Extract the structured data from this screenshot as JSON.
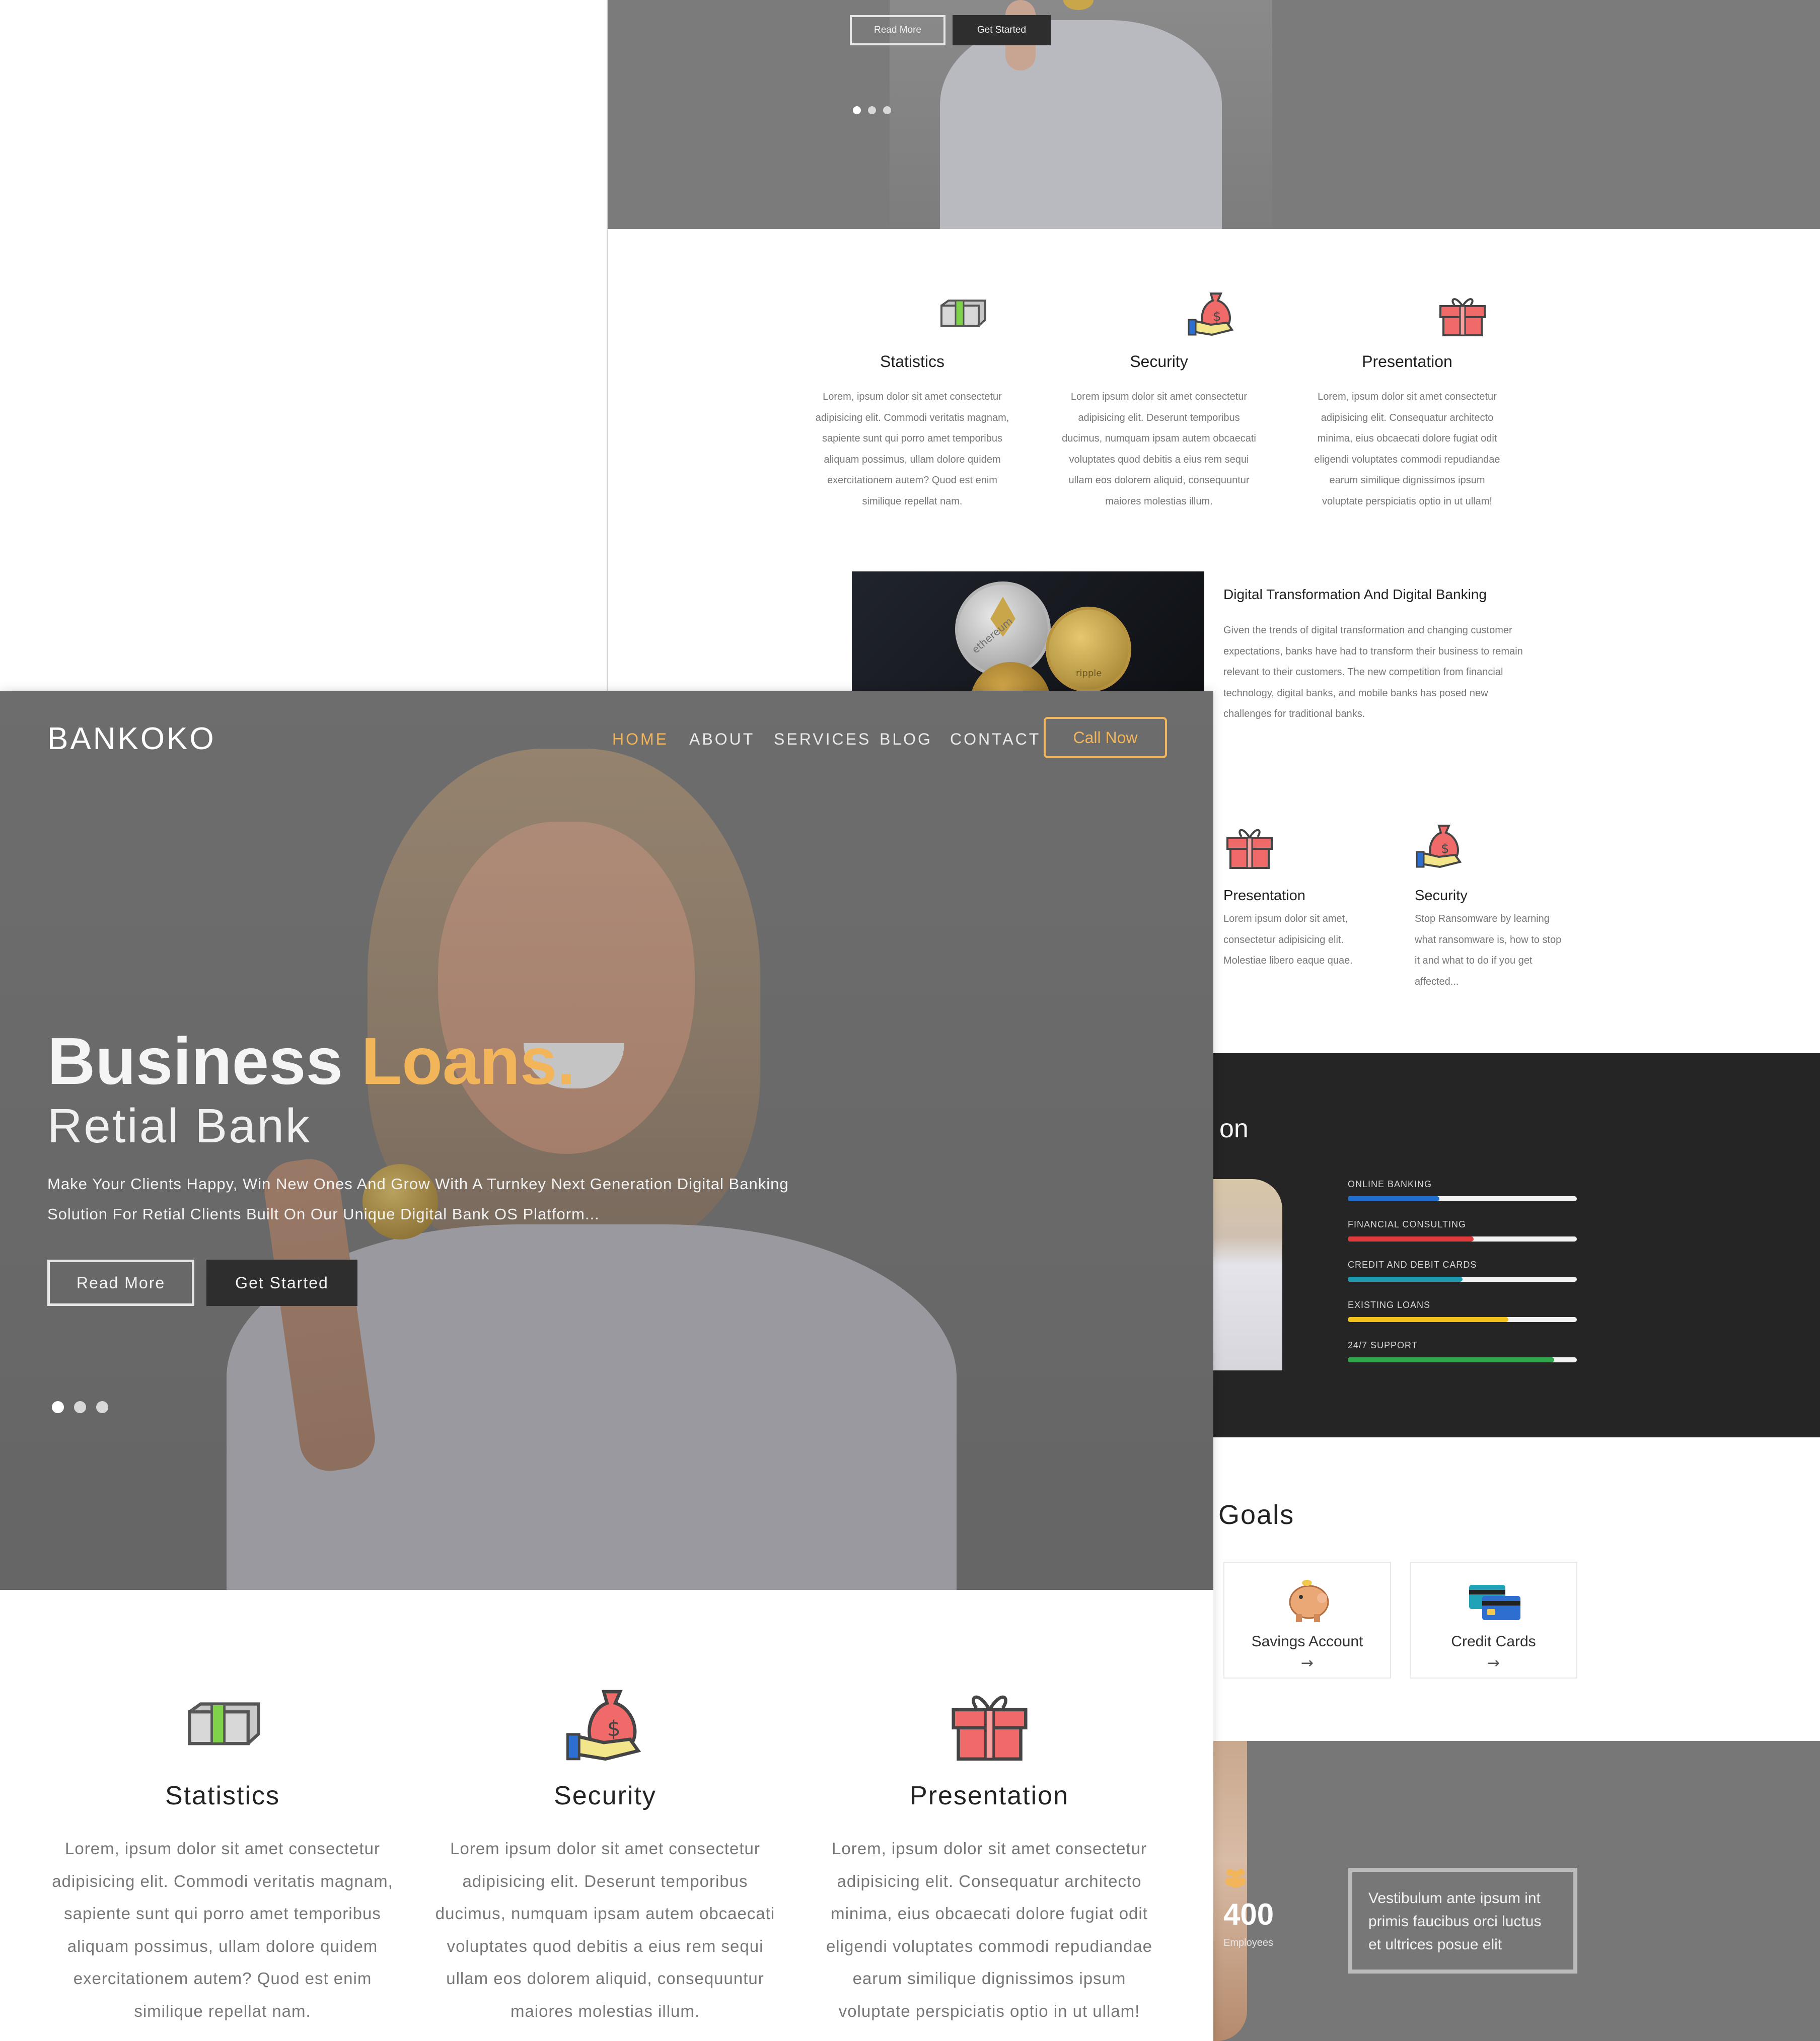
{
  "brand": "BANKOKO",
  "nav": {
    "items": [
      "HOME",
      "ABOUT",
      "SERVICES",
      "BLOG",
      "CONTACT"
    ],
    "active": "HOME",
    "cta": "Call Now"
  },
  "hero": {
    "title_plain": "Business",
    "title_accent": "Loans.",
    "subtitle": "Retial Bank",
    "desc_line1": "Make Your Clients Happy, Win New Ones And Grow With A Turnkey Next Generation Digital Banking",
    "desc_line2": "Solution For Retial Clients Built On Our Unique Digital Bank OS Platform...",
    "read_more": "Read More",
    "get_started": "Get Started",
    "slides": 3,
    "active_slide": 1
  },
  "features": [
    {
      "icon": "cash-icon",
      "title": "Statistics",
      "lines": [
        "Lorem, ipsum dolor sit amet consectetur",
        "adipisicing elit. Commodi veritatis magnam,",
        "sapiente sunt qui porro amet temporibus",
        "aliquam possimus, ullam dolore quidem",
        "exercitationem autem? Quod est enim",
        "similique repellat nam."
      ]
    },
    {
      "icon": "money-bag-icon",
      "title": "Security",
      "lines": [
        "Lorem ipsum dolor sit amet consectetur",
        "adipisicing elit. Deserunt temporibus",
        "ducimus, numquam ipsam autem obcaecati",
        "voluptates quod debitis a eius rem sequi",
        "ullam eos dolorem aliquid, consequuntur",
        "maiores molestias illum."
      ]
    },
    {
      "icon": "gift-icon",
      "title": "Presentation",
      "lines": [
        "Lorem, ipsum dolor sit amet consectetur",
        "adipisicing elit. Consequatur architecto",
        "minima, eius obcaecati dolore fugiat odit",
        "eligendi voluptates commodi repudiandae",
        "earum similique dignissimos ipsum",
        "voluptate perspiciatis optio in ut ullam!"
      ]
    }
  ],
  "about": {
    "title": "Digital Transformation And Digital Banking",
    "lines": [
      "Given the trends of digital transformation and changing customer",
      "expectations, banks have had to transform their business to remain",
      "relevant to their customers. The new competition from financial",
      "technology, digital banks, and mobile banks has posed new",
      "challenges for traditional banks."
    ],
    "coin_text_1": "ethereum",
    "coin_text_2": "ripple"
  },
  "mini_features": [
    {
      "icon": "gift-icon",
      "title": "Presentation",
      "lines": [
        "Lorem ipsum dolor sit amet,",
        "consectetur adipisicing elit.",
        "Molestiae libero eaque quae."
      ]
    },
    {
      "icon": "money-bag-icon",
      "title": "Security",
      "lines": [
        "Stop Ransomware by learning",
        "what ransomware is, how to stop",
        "it and what to do if you get",
        "affected..."
      ]
    }
  ],
  "skills": {
    "heading_fragment": "on",
    "bars": [
      {
        "label": "ONLINE BANKING",
        "value": 0.4,
        "color": "#1f6fd0"
      },
      {
        "label": "FINANCIAL CONSULTING",
        "value": 0.55,
        "color": "#e03a3a"
      },
      {
        "label": "CREDIT AND DEBIT CARDS",
        "value": 0.5,
        "color": "#1d9ab0"
      },
      {
        "label": "EXISTING LOANS",
        "value": 0.7,
        "color": "#f2c21a"
      },
      {
        "label": "24/7 SUPPORT",
        "value": 0.9,
        "color": "#2ea84a"
      }
    ]
  },
  "goals": {
    "heading_fragment": "Goals",
    "cards": [
      {
        "icon": "piggy-bank-icon",
        "label": "Savings Account",
        "arrow": "→"
      },
      {
        "icon": "credit-cards-icon",
        "label": "Credit Cards",
        "arrow": "→"
      }
    ]
  },
  "stats": {
    "number": "400",
    "label": "Employees",
    "quote_line1": "Vestibulum ante ipsum int",
    "quote_line2": "primis faucibus orci luctus",
    "quote_line3": "et ultrices posue elit"
  },
  "colors": {
    "accent": "#f2b55a",
    "dark": "#252525",
    "button_dark": "#2e2e2e",
    "hero_overlay": "#7a7a7a"
  }
}
